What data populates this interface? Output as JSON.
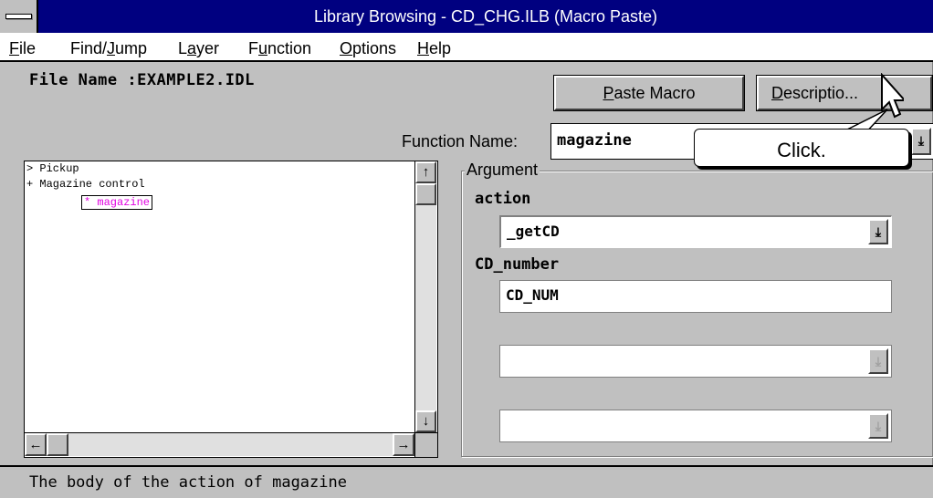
{
  "window": {
    "title": "Library Browsing - CD_CHG.ILB (Macro Paste)"
  },
  "menu": {
    "file": {
      "first": "F",
      "rest": "ile"
    },
    "find": {
      "pre": "Find/",
      "accel": "J",
      "rest": "ump"
    },
    "layer": {
      "pre": "L",
      "accel": "a",
      "rest": "yer"
    },
    "function": {
      "pre": "F",
      "accel": "u",
      "rest": "nction"
    },
    "options": {
      "first": "O",
      "rest": "ptions"
    },
    "help": {
      "first": "H",
      "rest": "elp"
    }
  },
  "header": {
    "file_name": "File Name :EXAMPLE2.IDL"
  },
  "buttons": {
    "paste_macro": {
      "accel": "P",
      "rest": "aste Macro"
    },
    "description": {
      "accel": "D",
      "rest": "escriptio..."
    }
  },
  "function_name": {
    "label": "Function Name:",
    "value": "magazine"
  },
  "tree": {
    "items": [
      "> Pickup",
      "+ Magazine control"
    ],
    "selected": "* magazine"
  },
  "argument": {
    "legend": "Argument",
    "action_label": "action",
    "action_value": "_getCD",
    "cd_number_label": "CD_number",
    "cd_number_value": "CD_NUM",
    "empty1_value": "",
    "empty2_value": ""
  },
  "callout": {
    "text": "Click."
  },
  "status": {
    "text": "The body of the action of magazine"
  },
  "icons": {
    "dropdown": "arrow-down-bar-icon",
    "scroll_up": "arrow-up-icon",
    "scroll_down": "arrow-down-icon",
    "scroll_left": "arrow-left-icon",
    "scroll_right": "arrow-right-icon",
    "pointer": "mouse-pointer-icon"
  },
  "colors": {
    "titlebar": "#000080",
    "selection_text": "#e000e0"
  }
}
